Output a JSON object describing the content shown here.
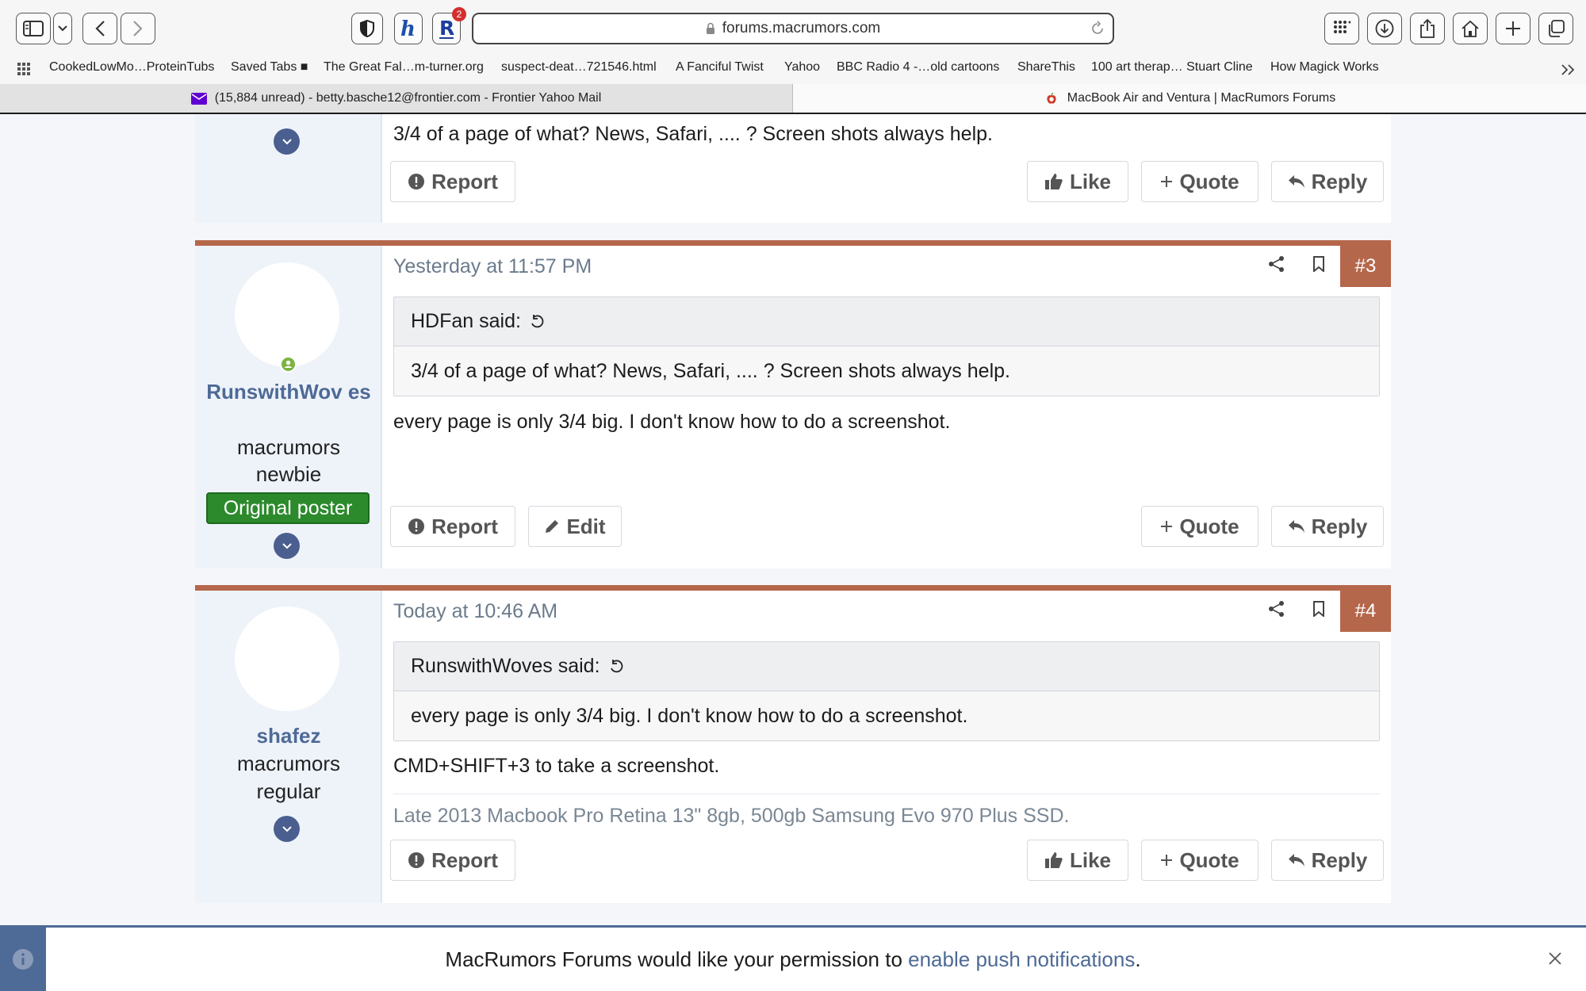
{
  "browser": {
    "url": "forums.macrumors.com",
    "extension_badge": "2",
    "bookmarks": [
      "CookedLowMo…ProteinTubs",
      "Saved Tabs ■",
      "The Great Fal…m-turner.org",
      "suspect-deat…721546.html",
      "A Fanciful Twist",
      "Yahoo",
      "BBC Radio 4 -…old cartoons",
      "ShareThis",
      "100 art therap… Stuart Cline",
      "How Magick Works"
    ],
    "tabs": [
      {
        "label": "(15,884 unread) - betty.basche12@frontier.com - Frontier Yahoo Mail"
      },
      {
        "label": "MacBook Air and Ventura | MacRumors Forums"
      }
    ]
  },
  "posts": {
    "prev": {
      "text": "3/4 of a page of what? News, Safari, .... ? Screen shots always help.",
      "actions": {
        "report": "Report",
        "like": "Like",
        "quote": "Quote",
        "reply": "Reply"
      }
    },
    "p3": {
      "username": "RunswithWov es",
      "user_title_line1": "macrumors",
      "user_title_line2": "newbie",
      "op_badge": "Original poster",
      "date": "Yesterday at 11:57 PM",
      "number": "#3",
      "quote_author": "HDFan said:",
      "quote_text": "3/4 of a page of what? News, Safari, .... ? Screen shots always help.",
      "text": "every page is only 3/4 big. I don't know how to do a screenshot.",
      "actions": {
        "report": "Report",
        "edit": "Edit",
        "quote": "Quote",
        "reply": "Reply"
      }
    },
    "p4": {
      "username": "shafez",
      "user_title_line1": "macrumors",
      "user_title_line2": "regular",
      "date": "Today at 10:46 AM",
      "number": "#4",
      "quote_author": "RunswithWoves said:",
      "quote_text": "every page is only 3/4 big. I don't know how to do a screenshot.",
      "text": "CMD+SHIFT+3 to take a screenshot.",
      "signature": "Late 2013 Macbook Pro Retina 13\" 8gb, 500gb Samsung Evo 970 Plus SSD.",
      "actions": {
        "report": "Report",
        "like": "Like",
        "quote": "Quote",
        "reply": "Reply"
      }
    }
  },
  "notification": {
    "text_before": "MacRumors Forums would like your permission to ",
    "link": "enable push notifications",
    "text_after": "."
  },
  "colors": {
    "accent": "#b5674b",
    "link": "#4e6a96",
    "op_badge": "#2c8a2c",
    "online": "#7cb342"
  }
}
